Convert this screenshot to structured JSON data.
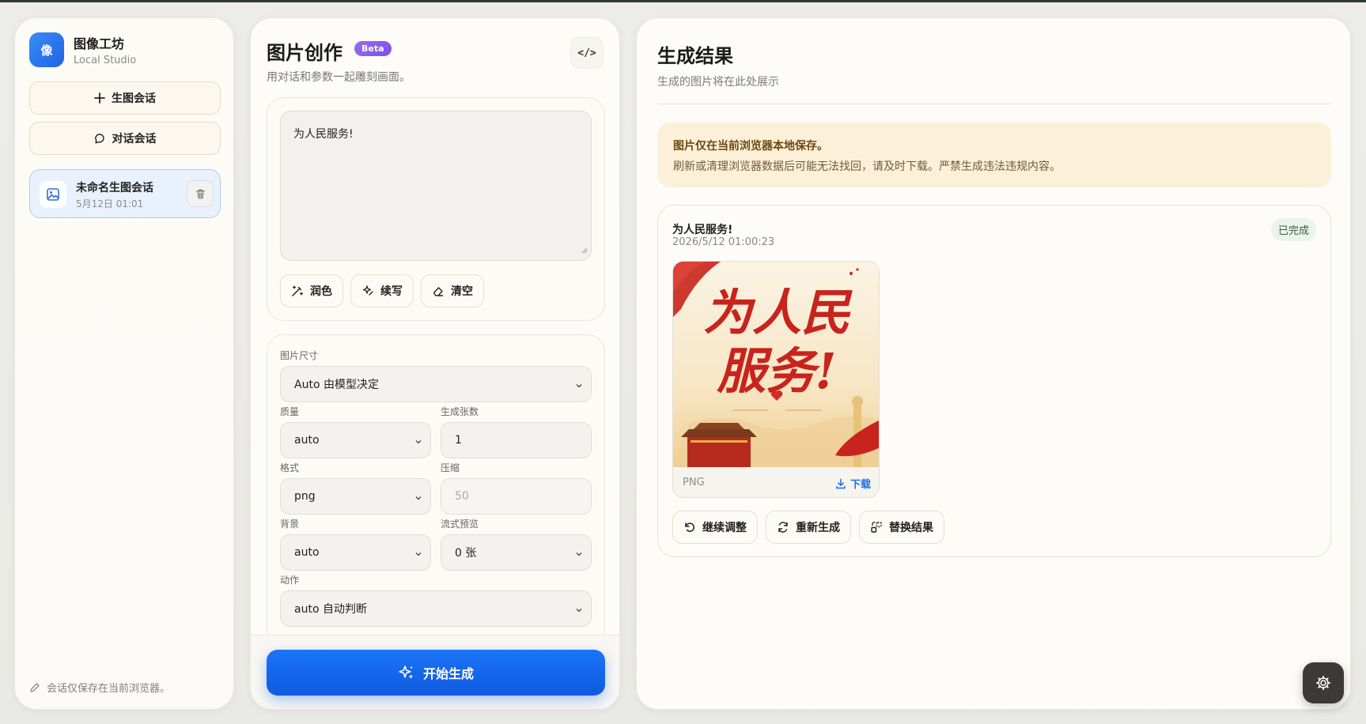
{
  "brand": {
    "logo_char": "像",
    "title": "图像工坊",
    "subtitle": "Local Studio"
  },
  "sidebar": {
    "new_image_session": "生图会话",
    "new_chat_session": "对话会话",
    "sessions": [
      {
        "title": "未命名生图会话",
        "date": "5月12日 01:01",
        "active": true
      }
    ],
    "footer_note": "会话仅保存在当前浏览器。"
  },
  "creator": {
    "title": "图片创作",
    "badge": "Beta",
    "code_label": "</>",
    "subtitle": "用对话和参数一起雕刻画面。",
    "prompt_value": "为人民服务!",
    "tools": {
      "polish": "润色",
      "continue": "续写",
      "clear": "清空"
    },
    "params": {
      "size_label": "图片尺寸",
      "size_value": "Auto 由模型决定",
      "quality_label": "质量",
      "quality_value": "auto",
      "count_label": "生成张数",
      "count_value": "1",
      "format_label": "格式",
      "format_value": "png",
      "compression_label": "压缩",
      "compression_value": "50",
      "background_label": "背景",
      "background_value": "auto",
      "stream_label": "流式预览",
      "stream_value": "0 张",
      "action_label": "动作",
      "action_value": "auto 自动判断"
    },
    "generate_label": "开始生成"
  },
  "results": {
    "title": "生成结果",
    "subtitle": "生成的图片将在此处展示",
    "notice_title": "图片仅在当前浏览器本地保存。",
    "notice_text": "刷新或清理浏览器数据后可能无法找回，请及时下载。严禁生成违法违规内容。",
    "item": {
      "prompt": "为人民服务!",
      "timestamp": "2026/5/12 01:00:23",
      "status": "已完成",
      "image_text_line1": "为人民",
      "image_text_line2": "服务!",
      "format": "PNG",
      "download_label": "下载"
    },
    "actions": {
      "adjust": "继续调整",
      "regenerate": "重新生成",
      "replace": "替换结果"
    }
  },
  "colors": {
    "accent": "#1a6ff0",
    "beta": "#8a5cf0",
    "notice_bg": "#fdf0d9",
    "poster_red": "#c8231c"
  }
}
